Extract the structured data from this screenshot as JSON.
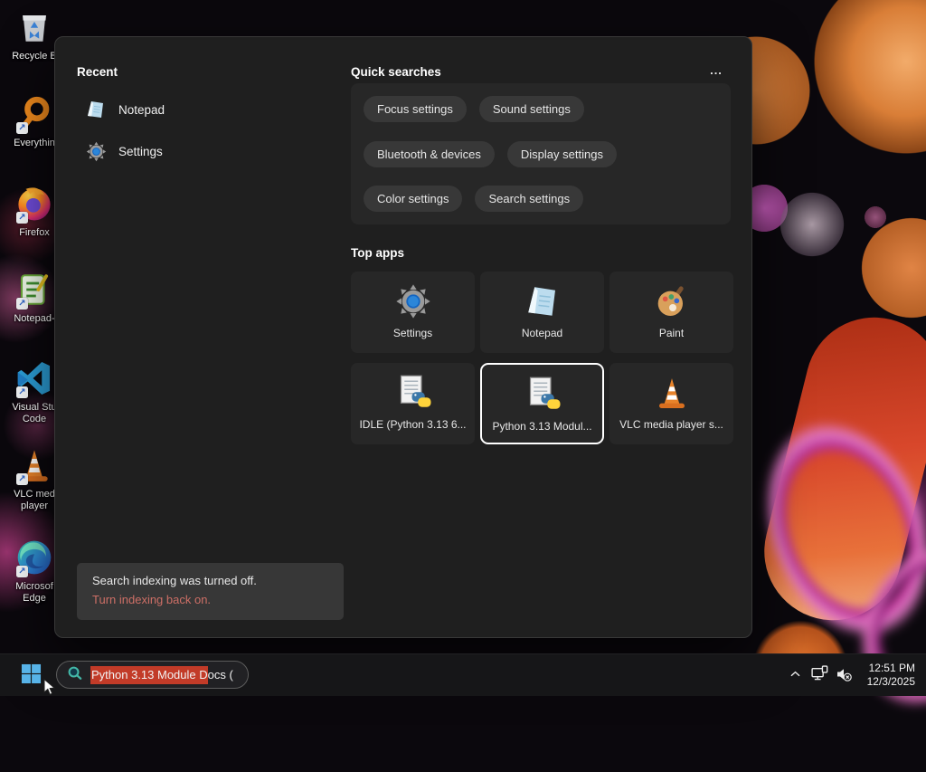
{
  "colors": {
    "highlight-red": "#c23b28",
    "link-red": "#cd6f66",
    "accent-blue": "#57b3e8"
  },
  "desktop": {
    "icons": [
      {
        "label": "Recycle B"
      },
      {
        "label": "Everythin"
      },
      {
        "label": "Firefox"
      },
      {
        "label": "Notepad-"
      },
      {
        "label": "Visual Stu\nCode"
      },
      {
        "label": "VLC med\nplayer"
      },
      {
        "label": "Microsof\nEdge"
      }
    ]
  },
  "search_panel": {
    "recent": {
      "title": "Recent",
      "items": [
        {
          "label": "Notepad"
        },
        {
          "label": "Settings"
        }
      ]
    },
    "quick_searches": {
      "title": "Quick searches",
      "more_label": "...",
      "pills": [
        "Focus settings",
        "Sound settings",
        "Bluetooth & devices",
        "Display settings",
        "Color settings",
        "Search settings"
      ]
    },
    "top_apps": {
      "title": "Top apps",
      "tiles": [
        {
          "label": "Settings",
          "selected": false
        },
        {
          "label": "Notepad",
          "selected": false
        },
        {
          "label": "Paint",
          "selected": false
        },
        {
          "label": "IDLE (Python 3.13 6...",
          "selected": false
        },
        {
          "label": "Python 3.13 Modul...",
          "selected": true
        },
        {
          "label": "VLC media player s...",
          "selected": false
        }
      ]
    },
    "notice": {
      "message": "Search indexing was turned off.",
      "link": "Turn indexing back on."
    }
  },
  "taskbar": {
    "search": {
      "highlighted_text": "Python 3.13 Module D",
      "rest_text": "ocs ("
    },
    "clock": {
      "time": "12:51 PM",
      "date": "12/3/2025"
    }
  }
}
